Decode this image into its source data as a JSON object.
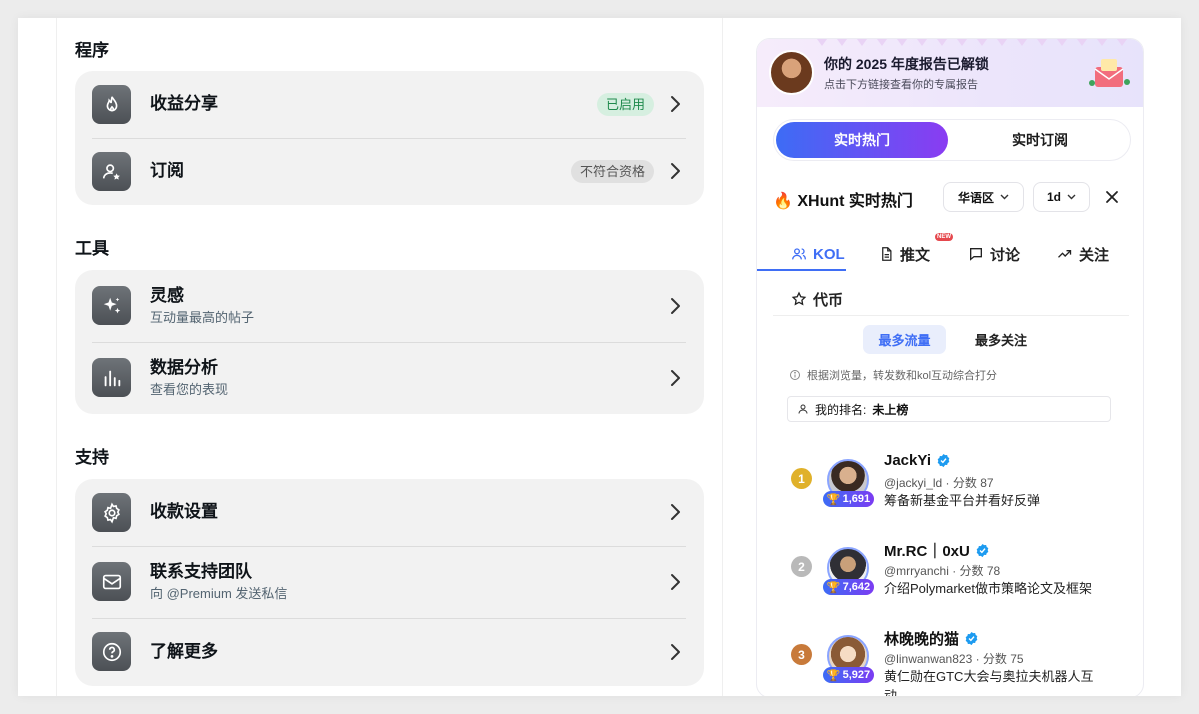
{
  "sections": {
    "program": {
      "title": "程序",
      "items": [
        {
          "title": "收益分享",
          "badge": "已启用"
        },
        {
          "title": "订阅",
          "badge": "不符合资格"
        }
      ]
    },
    "tools": {
      "title": "工具",
      "items": [
        {
          "title": "灵感",
          "subtitle": "互动量最高的帖子"
        },
        {
          "title": "数据分析",
          "subtitle": "查看您的表现"
        }
      ]
    },
    "support": {
      "title": "支持",
      "items": [
        {
          "title": "收款设置"
        },
        {
          "title": "联系支持团队",
          "subtitle": "向 @Premium 发送私信"
        },
        {
          "title": "了解更多"
        }
      ]
    }
  },
  "sidebar": {
    "banner": {
      "title": "你的 2025 年度报告已解锁",
      "subtitle": "点击下方链接查看你的专属报告"
    },
    "segment": {
      "active": "实时热门",
      "other": "实时订阅"
    },
    "header": {
      "title": "XHunt 实时热门",
      "region": "华语区",
      "period": "1d"
    },
    "tabs": [
      {
        "label": "KOL",
        "icon": "users-icon",
        "active": true
      },
      {
        "label": "推文",
        "icon": "document-icon",
        "new_badge": "NEW"
      },
      {
        "label": "讨论",
        "icon": "chat-icon"
      },
      {
        "label": "关注",
        "icon": "trending-icon"
      },
      {
        "label": "代币",
        "icon": "star-icon"
      }
    ],
    "sort": {
      "active": "最多流量",
      "other": "最多关注"
    },
    "hint": "根据浏览量，转发数和kol互动综合打分",
    "my_rank": {
      "label": "我的排名:",
      "value": "未上榜"
    },
    "ranking": [
      {
        "rank": "1",
        "name": "JackYi",
        "handle": "@jackyi_ld",
        "score": "分数 87",
        "followers": "1,691",
        "desc": "筹备新基金平台并看好反弹",
        "rank_color": "#e0b12a"
      },
      {
        "rank": "2",
        "name": "Mr.RC｜0xU",
        "handle": "@mrryanchi",
        "score": "分数 78",
        "followers": "7,642",
        "desc": "介绍Polymarket做市策略论文及框架",
        "rank_color": "#b9b9b9"
      },
      {
        "rank": "3",
        "name": "林晚晚的猫",
        "handle": "@linwanwan823",
        "score": "分数 75",
        "followers": "5,927",
        "desc": "黄仁勋在GTC大会与奥拉夫机器人互动",
        "rank_color": "#c87a3a"
      }
    ]
  },
  "colors": {
    "accent": "#3f6ef5",
    "enabled_badge": "#1f8a4c"
  }
}
